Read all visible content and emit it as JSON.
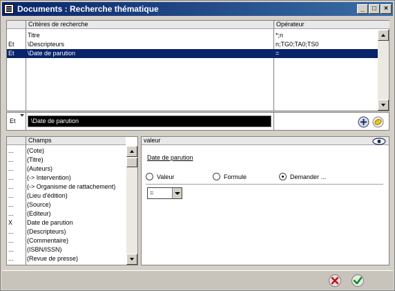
{
  "window": {
    "title": "Documents : Recherche thématique",
    "min_label": "_",
    "max_label": "□",
    "close_label": "×"
  },
  "criteria": {
    "header_op": "",
    "header_criteria": "Critères de recherche",
    "header_operator": "Opérateur",
    "rows": [
      {
        "connector": "",
        "criterion": "Titre",
        "operator": "*;n"
      },
      {
        "connector": "Et",
        "criterion": "\\Descripteurs",
        "operator": "n;TG0;TA0;TS0"
      },
      {
        "connector": "Et",
        "criterion": "\\Date de parution",
        "operator": "=",
        "selected": true
      }
    ],
    "edit": {
      "connector": "Et",
      "criterion": "\\Date de parution"
    },
    "add_icon": "plus-circle-icon",
    "erase_icon": "eraser-icon"
  },
  "fields": {
    "header_mark": "",
    "header_label": "Champs",
    "rows": [
      {
        "mark": "...",
        "label": "(Cote)"
      },
      {
        "mark": "...",
        "label": "(Titre)"
      },
      {
        "mark": "...",
        "label": "(Auteurs)"
      },
      {
        "mark": "...",
        "label": "(-> Intervention)"
      },
      {
        "mark": "...",
        "label": "(-> Organisme de rattachement)"
      },
      {
        "mark": "...",
        "label": "(Lieu d'édition)"
      },
      {
        "mark": "...",
        "label": "(Source)"
      },
      {
        "mark": "...",
        "label": "(Editeur)"
      },
      {
        "mark": "X",
        "label": "Date de parution"
      },
      {
        "mark": "...",
        "label": "(Descripteurs)"
      },
      {
        "mark": "...",
        "label": "(Commentaire)"
      },
      {
        "mark": "...",
        "label": "(ISBN/ISSN)"
      },
      {
        "mark": "...",
        "label": "(Revue de presse)"
      }
    ]
  },
  "value_panel": {
    "header": "valeur",
    "eye_icon": "eye-icon",
    "field_name": "Date de parution",
    "radio_valeur": "Valeur",
    "radio_formule": "Formule",
    "radio_demander": "Demander ...",
    "selected_radio": "demander",
    "operator_value": "="
  },
  "footer": {
    "cancel_icon": "cancel-icon",
    "ok_icon": "checkmark-icon"
  },
  "colors": {
    "selection": "#0a246a",
    "title_start": "#0a246a",
    "title_end": "#3a6ea5"
  }
}
